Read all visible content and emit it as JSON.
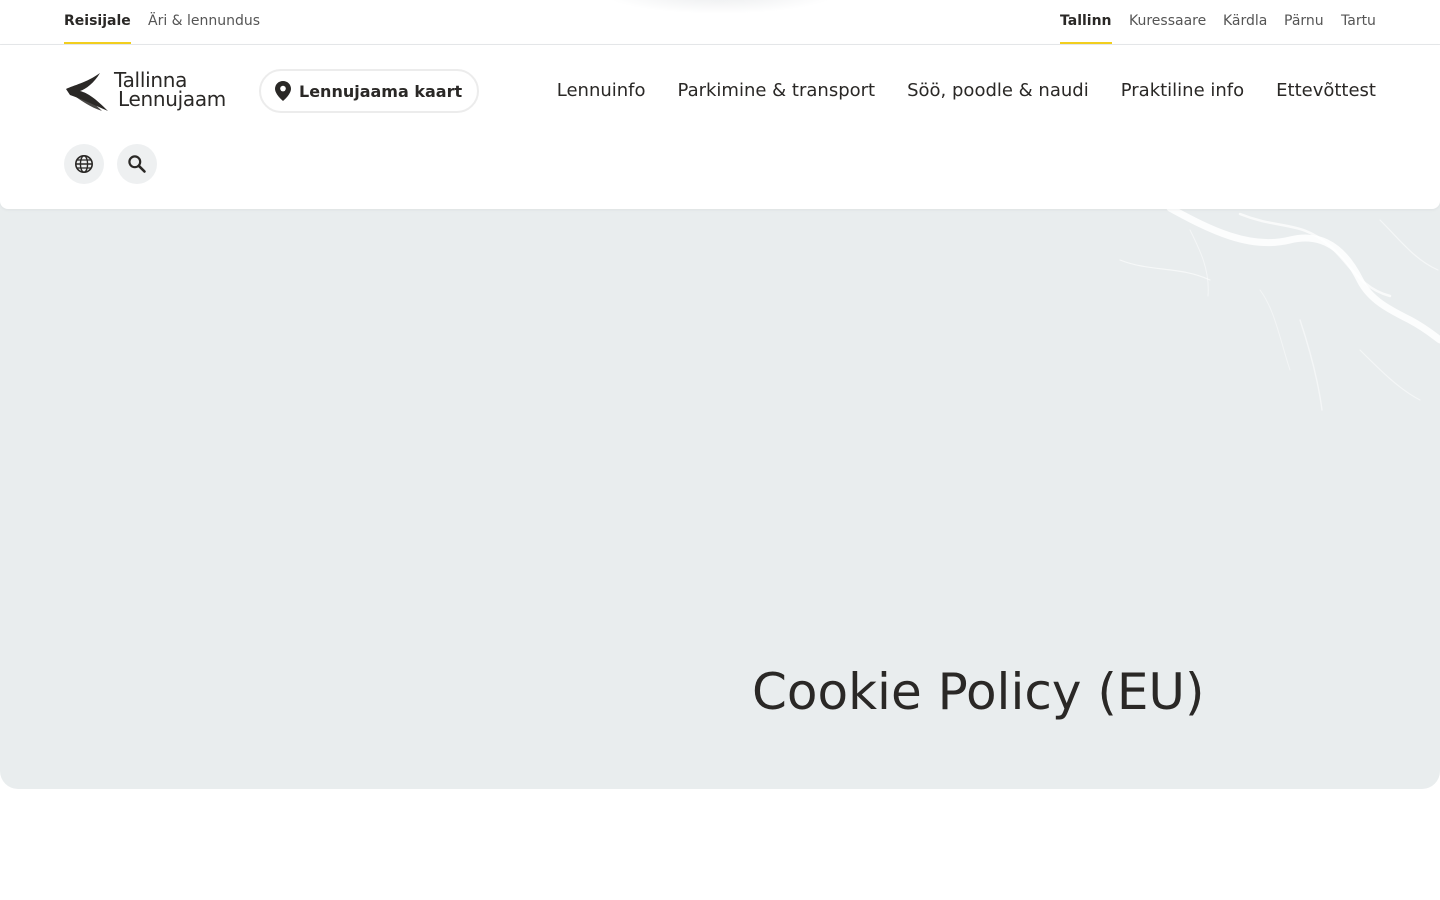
{
  "topbar": {
    "audience": [
      {
        "label": "Reisijale",
        "active": true
      },
      {
        "label": "Äri & lennundus",
        "active": false
      }
    ],
    "airports": [
      {
        "label": "Tallinn",
        "active": true
      },
      {
        "label": "Kuressaare",
        "active": false
      },
      {
        "label": "Kärdla",
        "active": false
      },
      {
        "label": "Pärnu",
        "active": false
      },
      {
        "label": "Tartu",
        "active": false
      }
    ]
  },
  "header": {
    "logo_line1": "Tallinna",
    "logo_line2": "Lennujaam",
    "map_button": "Lennujaama kaart",
    "nav": [
      "Lennuinfo",
      "Parkimine & transport",
      "Söö, poodle & naudi",
      "Praktiline info",
      "Ettevõttest"
    ],
    "icons": [
      "globe-icon",
      "search-icon"
    ]
  },
  "hero": {
    "title": "Cookie Policy (EU)"
  },
  "colors": {
    "accent": "#f2cf1f",
    "text": "#2a2826",
    "hero_bg": "#e9edee"
  }
}
